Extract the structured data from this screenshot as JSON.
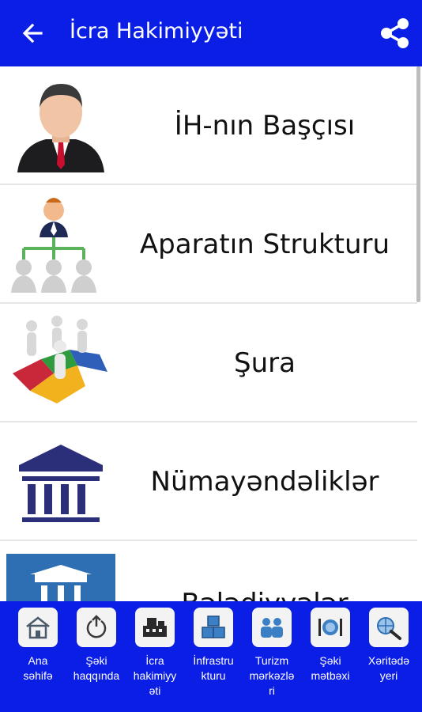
{
  "header": {
    "title": "İcra Hakimiyyəti",
    "back_icon": "arrow-left-icon",
    "share_icon": "share-icon"
  },
  "list": {
    "items": [
      {
        "label": "İH-nın Başçısı",
        "icon": "businessman-avatar"
      },
      {
        "label": "Aparatın Strukturu",
        "icon": "org-structure"
      },
      {
        "label": "Şura",
        "icon": "puzzle-team"
      },
      {
        "label": "Nümayəndəliklər",
        "icon": "institution-building"
      },
      {
        "label": "Bələdiyyələr",
        "icon": "municipality-building"
      }
    ]
  },
  "bottom_nav": {
    "items": [
      {
        "label": "Ana\nsəhifə",
        "icon": "home-icon"
      },
      {
        "label": "Şəki\nhaqqında",
        "icon": "power-icon"
      },
      {
        "label": "İcra\nhakimiyy\nəti",
        "icon": "office-icon"
      },
      {
        "label": "İnfrastru\nkturu",
        "icon": "blocks-icon"
      },
      {
        "label": "Turizm\nmərkəzlə\nri",
        "icon": "people-icon"
      },
      {
        "label": "Şəki\nmətbəxi",
        "icon": "dining-icon"
      },
      {
        "label": "Xəritədə\nyeri",
        "icon": "globe-search-icon"
      }
    ]
  },
  "colors": {
    "primary": "#0a1ee6",
    "institution": "#2b2f7a",
    "municipality": "#2d6fb2"
  }
}
